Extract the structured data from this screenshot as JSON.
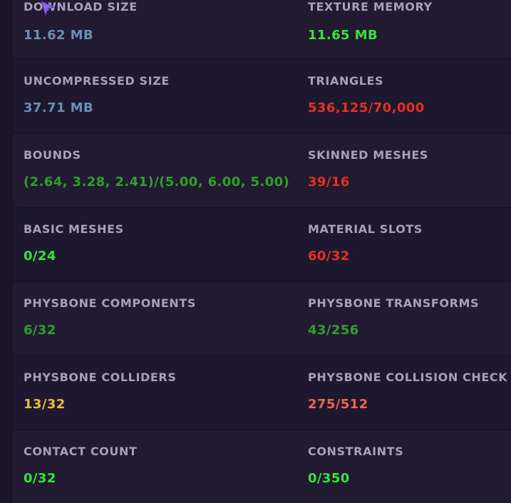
{
  "colors": {
    "label": "#a7a1b6",
    "neutral_blue": "#6a8fb7",
    "good_bright": "#39e43a",
    "good_dark": "#2ea12a",
    "bad_red": "#e5311f",
    "warn_yellow": "#f0b83d",
    "warn_orange": "#f2654b"
  },
  "rows": [
    {
      "left": {
        "label": "DOWNLOAD SIZE",
        "value": "11.62 MB",
        "status": "neutral_blue"
      },
      "right": {
        "label": "TEXTURE MEMORY",
        "value": "11.65 MB",
        "status": "good_bright"
      }
    },
    {
      "left": {
        "label": "UNCOMPRESSED SIZE",
        "value": "37.71 MB",
        "status": "neutral_blue"
      },
      "right": {
        "label": "TRIANGLES",
        "value": "536,125/70,000",
        "status": "bad_red"
      }
    },
    {
      "left": {
        "label": "BOUNDS",
        "value": "(2.64, 3.28, 2.41)/(5.00, 6.00, 5.00)",
        "status": "good_dark"
      },
      "right": {
        "label": "SKINNED MESHES",
        "value": "39/16",
        "status": "bad_red"
      }
    },
    {
      "left": {
        "label": "BASIC MESHES",
        "value": "0/24",
        "status": "good_bright"
      },
      "right": {
        "label": "MATERIAL SLOTS",
        "value": "60/32",
        "status": "bad_red"
      }
    },
    {
      "left": {
        "label": "PHYSBONE COMPONENTS",
        "value": "6/32",
        "status": "good_dark"
      },
      "right": {
        "label": "PHYSBONE TRANSFORMS",
        "value": "43/256",
        "status": "good_dark"
      }
    },
    {
      "left": {
        "label": "PHYSBONE COLLIDERS",
        "value": "13/32",
        "status": "warn_yellow"
      },
      "right": {
        "label": "PHYSBONE COLLISION CHECK CO",
        "value": "275/512",
        "status": "warn_orange"
      }
    },
    {
      "left": {
        "label": "CONTACT COUNT",
        "value": "0/32",
        "status": "good_bright"
      },
      "right": {
        "label": "CONSTRAINTS",
        "value": "0/350",
        "status": "good_bright"
      }
    }
  ],
  "cursor": {
    "icon": "mouse-pointer-icon",
    "color": "#8a63e8"
  }
}
